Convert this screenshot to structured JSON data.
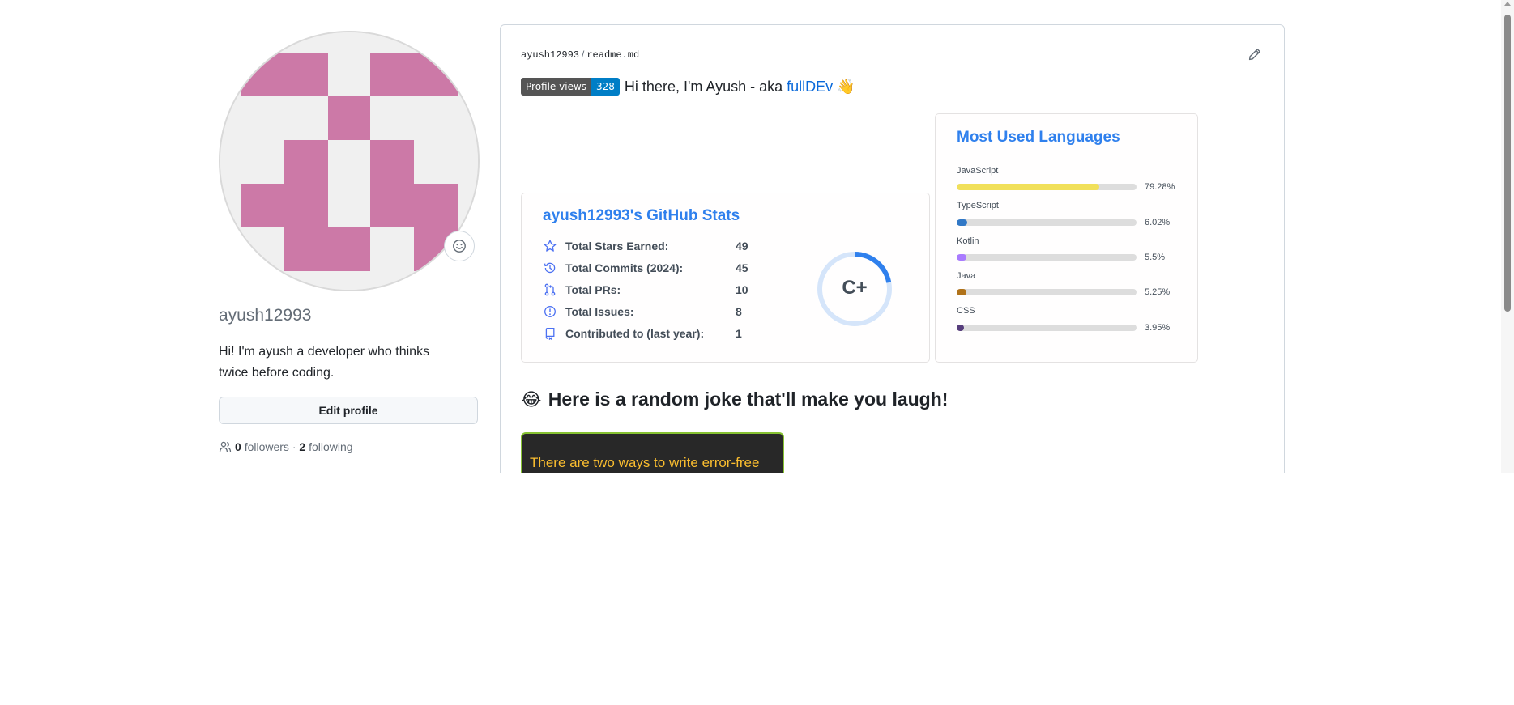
{
  "profile": {
    "username": "ayush12993",
    "bio": "Hi! I'm ayush a developer who thinks twice before coding.",
    "edit_button": "Edit profile",
    "followers_count": "0",
    "followers_label": "followers",
    "separator": "·",
    "following_count": "2",
    "following_label": "following",
    "avatar_color": "#cc79a7"
  },
  "readme": {
    "owner": "ayush12993",
    "separator": "/",
    "file": "readme.md",
    "badge_label": "Profile views",
    "badge_value": "328",
    "greeting_text": "Hi there, I'm Ayush - aka ",
    "greeting_link": "fullDEv",
    "greeting_emoji": "👋"
  },
  "github_stats": {
    "title": "ayush12993's GitHub Stats",
    "rows": [
      {
        "icon": "star-icon",
        "label": "Total Stars Earned:",
        "value": "49"
      },
      {
        "icon": "history-icon",
        "label": "Total Commits (2024):",
        "value": "45"
      },
      {
        "icon": "pull-request-icon",
        "label": "Total PRs:",
        "value": "10"
      },
      {
        "icon": "issue-icon",
        "label": "Total Issues:",
        "value": "8"
      },
      {
        "icon": "repo-icon",
        "label": "Contributed to (last year):",
        "value": "1"
      }
    ],
    "rank": "C+",
    "rank_progress": 0.22,
    "accent_color": "#2f80ed"
  },
  "languages": {
    "title": "Most Used Languages",
    "items": [
      {
        "name": "JavaScript",
        "percent": "79.28%",
        "value": 79.28,
        "color": "#f1e05a"
      },
      {
        "name": "TypeScript",
        "percent": "6.02%",
        "value": 6.02,
        "color": "#3178c6"
      },
      {
        "name": "Kotlin",
        "percent": "5.5%",
        "value": 5.5,
        "color": "#a97bff"
      },
      {
        "name": "Java",
        "percent": "5.25%",
        "value": 5.25,
        "color": "#b07219"
      },
      {
        "name": "CSS",
        "percent": "3.95%",
        "value": 3.95,
        "color": "#563d7c"
      }
    ]
  },
  "joke": {
    "emoji": "😂",
    "heading": "Here is a random joke that'll make you laugh!",
    "text": "There are two ways to write error-free"
  }
}
